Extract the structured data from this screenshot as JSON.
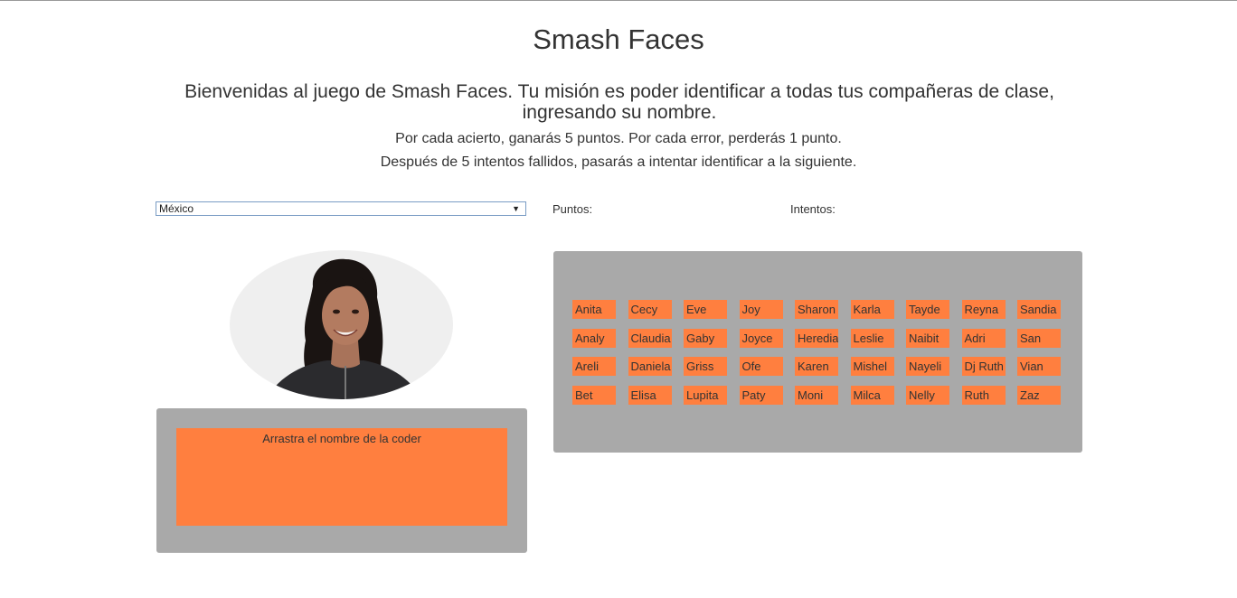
{
  "header": {
    "title": "Smash Faces",
    "intro": "Bienvenidas al juego de Smash Faces. Tu misión es poder identificar a todas tus compañeras de clase, ingresando su nombre.",
    "rule_points": "Por cada acierto, ganarás 5 puntos. Por cada error, perderás 1 punto.",
    "rule_attempts": "Después de 5 intentos fallidos, pasarás a intentar identificar a la siguiente."
  },
  "controls": {
    "country_selected": "México",
    "points_label": "Puntos:",
    "attempts_label": "Intentos:"
  },
  "drop_zone": {
    "label": "Arrastra el nombre de la coder"
  },
  "names": [
    "Anita",
    "Cecy",
    "Eve",
    "Joy",
    "Sharon",
    "Karla",
    "Tayde",
    "Reyna",
    "Sandia",
    "Analy",
    "Claudia",
    "Gaby",
    "Joyce",
    "Heredia",
    "Leslie",
    "Naibit",
    "Adri",
    "San",
    "Areli",
    "Daniela",
    "Griss",
    "Ofe",
    "Karen",
    "Mishel",
    "Nayeli",
    "Dj Ruth",
    "Vian",
    "Bet",
    "Elisa",
    "Lupita",
    "Paty",
    "Moni",
    "Milca",
    "Nelly",
    "Ruth",
    "Zaz"
  ],
  "colors": {
    "accent_orange": "#ff7f3f",
    "panel_gray": "#a9a9a9",
    "photo_bg": "#efefef"
  }
}
